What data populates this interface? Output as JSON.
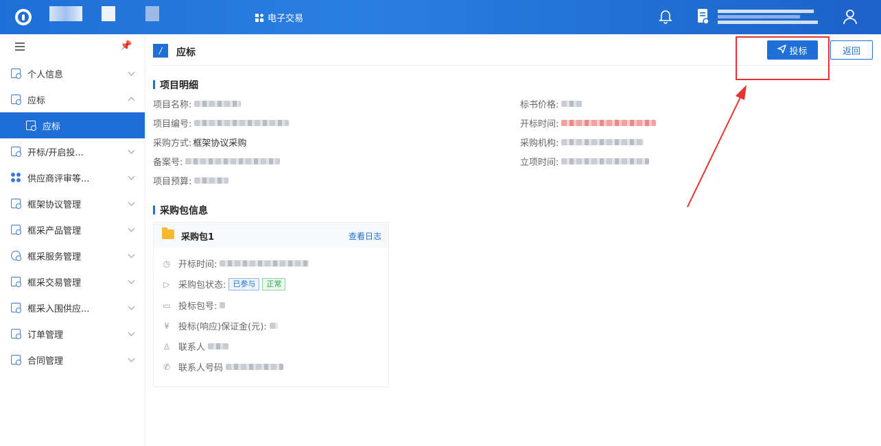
{
  "topbar": {
    "module_label": "电子交易"
  },
  "sidebar": {
    "items": [
      {
        "label": "个人信息",
        "expanded": false
      },
      {
        "label": "应标",
        "expanded": true
      },
      {
        "label": "应标",
        "active": true
      },
      {
        "label": "开标/开启投...",
        "expanded": false
      },
      {
        "label": "供应商评审等...",
        "expanded": false
      },
      {
        "label": "框架协议管理",
        "expanded": false
      },
      {
        "label": "框采产品管理",
        "expanded": false
      },
      {
        "label": "框采服务管理",
        "expanded": false
      },
      {
        "label": "框采交易管理",
        "expanded": false
      },
      {
        "label": "框采入围供应...",
        "expanded": false
      },
      {
        "label": "订单管理",
        "expanded": false
      },
      {
        "label": "合同管理",
        "expanded": false
      }
    ]
  },
  "page": {
    "title": "应标",
    "bid_button": "投标",
    "back_button": "返回"
  },
  "project": {
    "section_title": "项目明细",
    "name_label": "项目名称:",
    "number_label": "项目编号:",
    "method_label": "采购方式:",
    "method_value": "框架协议采购",
    "record_label": "备案号:",
    "budget_label": "项目预算:",
    "price_label": "标书价格:",
    "open_time_label": "开标时间:",
    "agency_label": "采购机构:",
    "setup_time_label": "立项时间:"
  },
  "package": {
    "section_title": "采购包信息",
    "card_title": "采购包1",
    "log_link": "查看日志",
    "open_time_label": "开标时间:",
    "status_label": "采购包状态:",
    "status_tags": [
      "已参与",
      "正常"
    ],
    "pkg_no_label": "投标包号:",
    "deposit_label": "投标(响应)保证金(元):",
    "contact_label": "联系人",
    "phone_label": "联系人号码"
  },
  "colors": {
    "primary": "#1f6fd6",
    "annotation_red": "#e8322d",
    "tag_green": "#27a547"
  }
}
